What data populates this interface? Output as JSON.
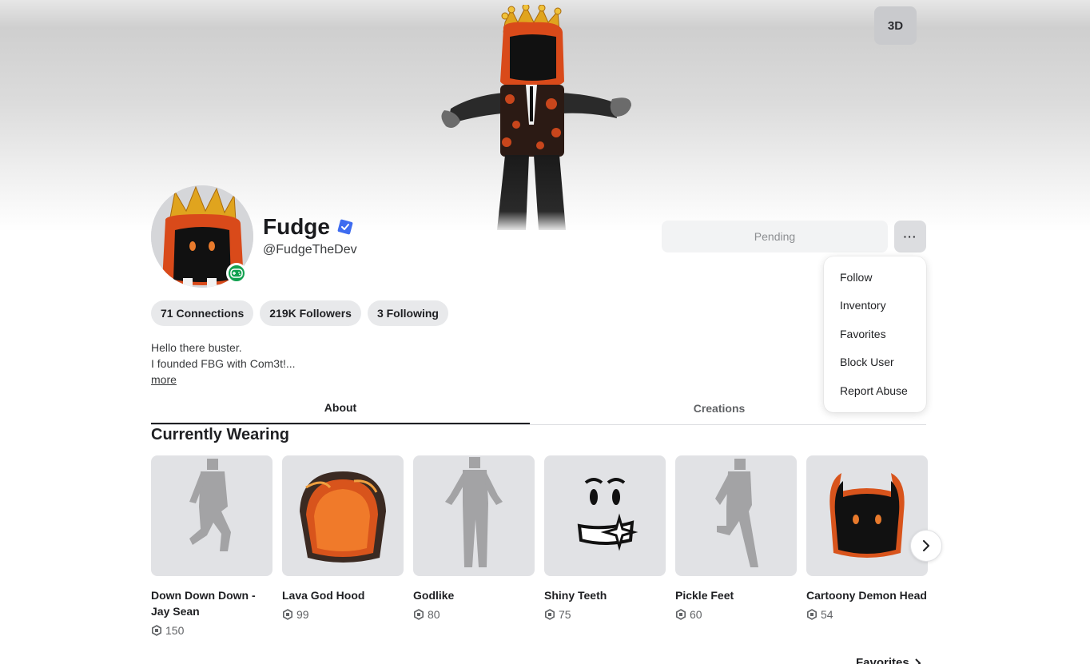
{
  "banner": {
    "view_mode_label": "3D"
  },
  "profile": {
    "display_name": "Fudge",
    "username": "@FudgeTheDev",
    "presence": "in-game",
    "verified": true
  },
  "actions": {
    "pending_label": "Pending",
    "more_label": "···"
  },
  "menu": {
    "items": [
      "Follow",
      "Inventory",
      "Favorites",
      "Block User",
      "Report Abuse"
    ]
  },
  "stats": {
    "connections": "71 Connections",
    "followers": "219K Followers",
    "following": "3 Following"
  },
  "bio": {
    "line1": "Hello there buster.",
    "line2": "I founded FBG with Com3t!...",
    "more_label": "more"
  },
  "tabs": {
    "about": "About",
    "creations": "Creations",
    "active": "About"
  },
  "wearing": {
    "title": "Currently Wearing",
    "items": [
      {
        "name": "Down Down Down - Jay Sean",
        "price": "150",
        "icon": "emote-silhouette"
      },
      {
        "name": "Lava God Hood",
        "price": "99",
        "icon": "lava-hood"
      },
      {
        "name": "Godlike",
        "price": "80",
        "icon": "emote-silhouette"
      },
      {
        "name": "Shiny Teeth",
        "price": "75",
        "icon": "face"
      },
      {
        "name": "Pickle Feet",
        "price": "60",
        "icon": "emote-silhouette"
      },
      {
        "name": "Cartoony Demon Head",
        "price": "54",
        "icon": "demon-head"
      }
    ]
  },
  "footer": {
    "favorites_label": "Favorites"
  },
  "colors": {
    "accent_verified": "#3e6cf0",
    "presence_green": "#12a150",
    "pill_bg": "#e8e9eb",
    "thumb_bg": "#e1e2e5"
  }
}
